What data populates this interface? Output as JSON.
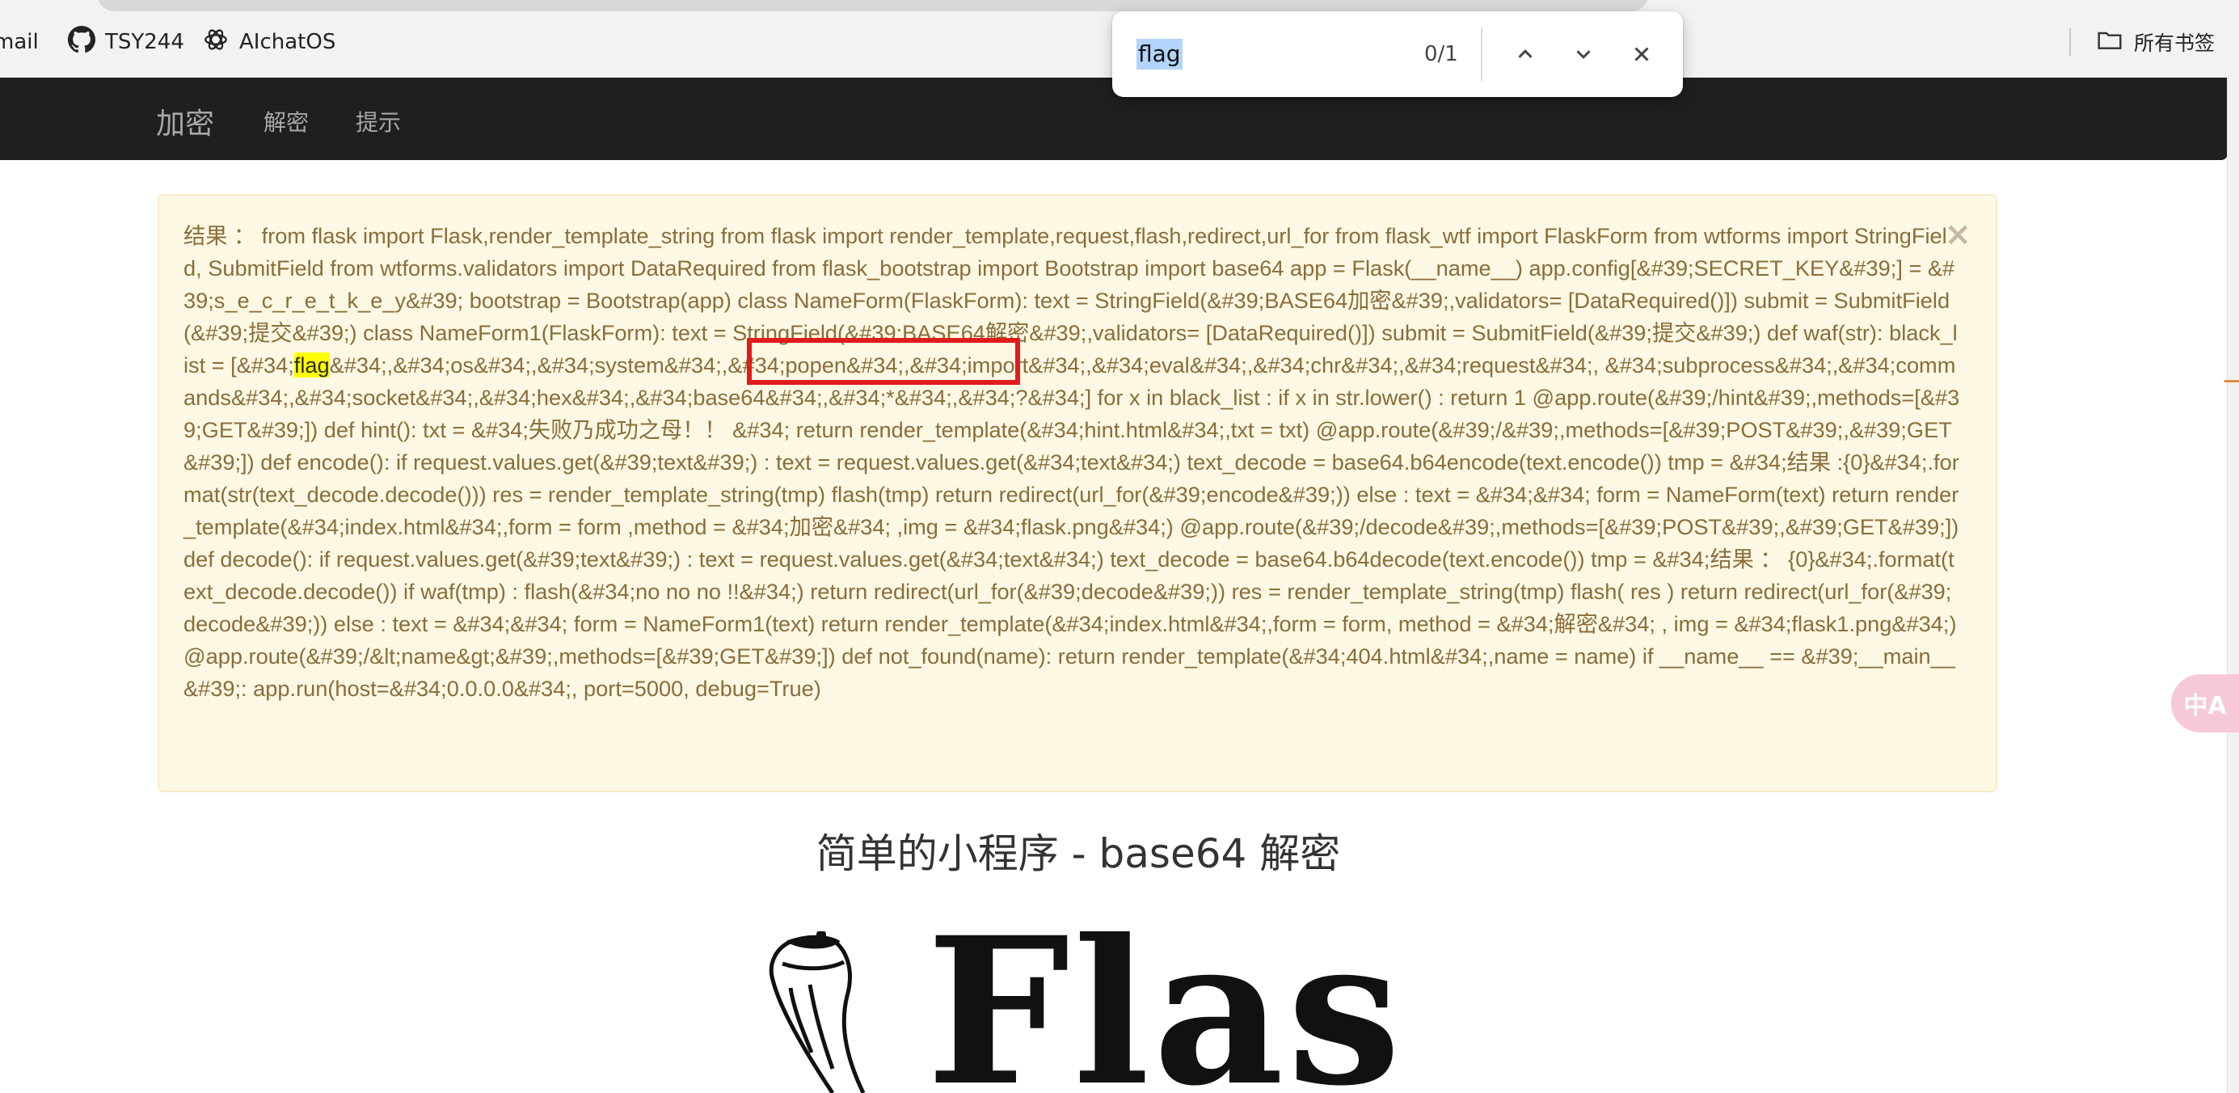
{
  "browser": {
    "bookmarks": [
      {
        "label": "mail",
        "icon": "mail-icon"
      },
      {
        "label": "TSY244",
        "icon": "github-icon"
      },
      {
        "label": "AIchatOS",
        "icon": "openai-icon"
      }
    ],
    "all_bookmarks_label": "所有书签"
  },
  "find_bar": {
    "query": "flag",
    "count": "0/1"
  },
  "navbar": {
    "brand": "加密",
    "links": [
      "解密",
      "提示"
    ]
  },
  "alert": {
    "text_before_box": "结果 ：  from flask import Flask,render_template_string from flask import render_template,request,flash,redirect,url_for from flask_wtf import FlaskForm from wtforms import StringField, SubmitField from wtforms.validators import DataRequired from flask_bootstrap import Bootstrap import base64 app = Flask(__name__) app.config[&#39;SECRET_KEY&#39;] = &#39;s_e_c_r_e_t_k_e_y&#39; bootstrap = Bootstrap(app) class NameForm(FlaskForm): text = StringField(&#39;BASE64加密&#39;,validators= [DataRequired()]) submit = SubmitField(&#39;提交&#39;) class NameForm1(FlaskForm): text = StringField(&#39;BASE64解密&#39;,validators= [DataRequired()]) submit = SubmitField(&#39;提交&#39;) ",
    "boxed_text": "def waf(str): black_list =",
    "text_before_match": " [&#34;",
    "match": "flag",
    "text_after_match": "&#34;,&#34;os&#34;,&#34;system&#34;,&#34;popen&#34;,&#34;import&#34;,&#34;eval&#34;,&#34;chr&#34;,&#34;request&#34;, &#34;subprocess&#34;,&#34;commands&#34;,&#34;socket&#34;,&#34;hex&#34;,&#34;base64&#34;,&#34;*&#34;,&#34;?&#34;] for x in black_list : if x in str.lower() : return 1 @app.route(&#39;/hint&#39;,methods=[&#39;GET&#39;]) def hint(): txt = &#34;失败乃成功之母！！ &#34; return render_template(&#34;hint.html&#34;,txt = txt) @app.route(&#39;/&#39;,methods=[&#39;POST&#39;,&#39;GET&#39;]) def encode(): if request.values.get(&#39;text&#39;) : text = request.values.get(&#34;text&#34;) text_decode = base64.b64encode(text.encode()) tmp = &#34;结果 :{0}&#34;.format(str(text_decode.decode())) res = render_template_string(tmp) flash(tmp) return redirect(url_for(&#39;encode&#39;)) else : text = &#34;&#34; form = NameForm(text) return render_template(&#34;index.html&#34;,form = form ,method = &#34;加密&#34; ,img = &#34;flask.png&#34;) @app.route(&#39;/decode&#39;,methods=[&#39;POST&#39;,&#39;GET&#39;]) def decode(): if request.values.get(&#39;text&#39;) : text = request.values.get(&#34;text&#34;) text_decode = base64.b64decode(text.encode()) tmp = &#34;结果 ：  {0}&#34;.format(text_decode.decode()) if waf(tmp) : flash(&#34;no no no !!&#34;) return redirect(url_for(&#39;decode&#39;)) res = render_template_string(tmp) flash( res ) return redirect(url_for(&#39;decode&#39;)) else : text = &#34;&#34; form = NameForm1(text) return render_template(&#34;index.html&#34;,form = form, method = &#34;解密&#34; , img = &#34;flask1.png&#34;) @app.route(&#39;/&lt;name&gt;&#39;,methods=[&#39;GET&#39;]) def not_found(name): return render_template(&#34;404.html&#34;,name = name) if __name__ == &#39;__main__&#39;: app.run(host=&#34;0.0.0.0&#34;, port=5000, debug=True)",
    "close_symbol": "×"
  },
  "page_title": "简单的小程序 - base64 解密",
  "logo_text": "Flask",
  "translate_fab_label": "中A",
  "colors": {
    "navbar_bg": "#1f1f1f",
    "alert_bg": "#fcf8e3",
    "alert_text": "#8a6d3b",
    "highlight": "#ffff00",
    "annotation_red": "#e01b1b"
  }
}
